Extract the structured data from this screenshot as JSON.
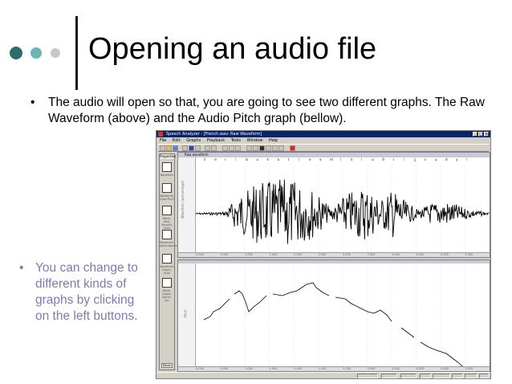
{
  "slide": {
    "title": "Opening an audio file",
    "bullet_char": "•",
    "bullet_text": "The audio will open so that, you are going to see two different graphs. The Raw Waveform (above) and the Audio Pitch graph (bellow).",
    "side_note": "You can change to different kinds of graphs by clicking on the left buttons.",
    "dot_colors": [
      "#2e6b6b",
      "#6fb4b4",
      "#c8c8c8"
    ],
    "accent_color": "#7b7bb4"
  },
  "app": {
    "window_title": "Speech Analyzer - [French.wav: Raw Waveform]",
    "menu": [
      "File",
      "Edit",
      "Graphs",
      "Playback",
      "Tools",
      "Window",
      "Help"
    ],
    "sidebar_tab": "Properties",
    "sidebar_buttons": [
      "Waveform",
      "Waveform, Auto Pitch",
      "Wave, Raw, Smooth, Auto",
      "Waveform, Spectrogram",
      "Waveform, Graph, Auto",
      "Wave, Graph, Spectr, Lpc"
    ],
    "mode_button": "Music",
    "waveform_panel_title": "Raw waveform",
    "waveform_y_label": "Waveform (percentage)",
    "pitch_y_label": "Pitch",
    "phonetic_transcription": [
      "ɛ̃",
      "e",
      "r",
      "i",
      "b",
      "u",
      "k",
      "a",
      "t",
      "i",
      "e",
      "a",
      "m",
      "i",
      "k",
      "i",
      "ʁ",
      "ð",
      "ɪ",
      "i",
      "ʒ",
      "s",
      "ɥ",
      "d",
      "y",
      "i"
    ],
    "x_ticks": [
      "0.000",
      "0.500",
      "1.000",
      "1.500",
      "2.000",
      "2.500",
      "3.000",
      "3.500",
      "4.000",
      "4.500",
      "5.000",
      "5.500"
    ],
    "status_cells": [
      "",
      "",
      "",
      "",
      "",
      "",
      "",
      ""
    ]
  }
}
